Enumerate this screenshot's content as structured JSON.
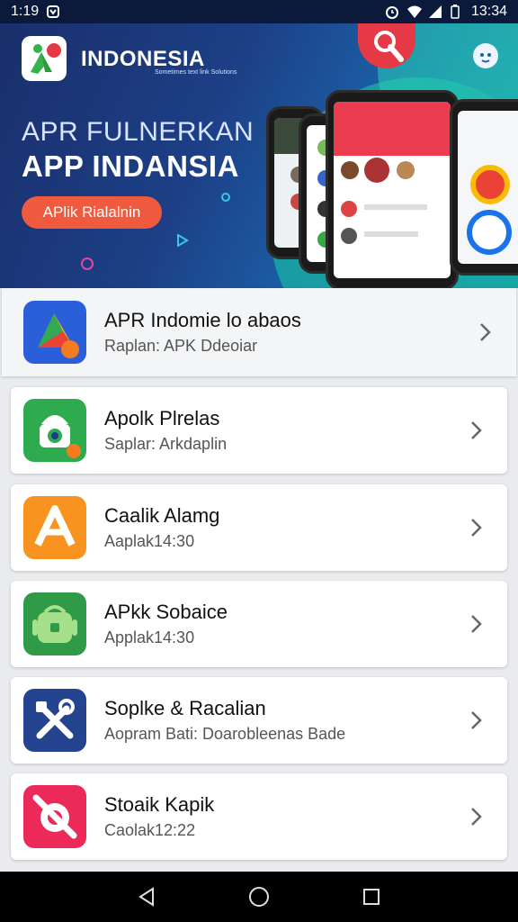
{
  "status_bar": {
    "time_left": "1:19",
    "time_right": "13:34"
  },
  "banner": {
    "brand_name": "INDONESIA",
    "brand_tagline": "Sometimes text link Solutions",
    "headline_1": "APR FULNERKAN",
    "headline_2": "APP INDANSIA",
    "cta_label": "APlik Rialalnin"
  },
  "apps": [
    {
      "title": "APR Indomie lo abaos",
      "subtitle": "Raplan: APK Ddeoiar",
      "icon": "play-store-icon",
      "icon_color": "#2b5fd9"
    },
    {
      "title": "Apolk Plrelas",
      "subtitle": "Saplar: Arkdaplin",
      "icon": "camera-lock-icon",
      "icon_color": "#2eaa4f"
    },
    {
      "title": "Caalik Alamg",
      "subtitle": "Aaplak14:30",
      "icon": "letter-a-icon",
      "icon_color": "#f7931e"
    },
    {
      "title": "APkk Sobaice",
      "subtitle": "Applak14:30",
      "icon": "android-bag-icon",
      "icon_color": "#2f9b48"
    },
    {
      "title": "Soplke & Racalian",
      "subtitle": "Aopram Bati: Doarobleenas Bade",
      "icon": "tools-icon",
      "icon_color": "#24448f"
    },
    {
      "title": "Stoaik Kapik",
      "subtitle": "Caolak12:22",
      "icon": "no-camera-icon",
      "icon_color": "#ec2a5a"
    }
  ],
  "colors": {
    "banner_start": "#1a2f6b",
    "banner_end": "#17a9a8",
    "cta": "#f05a3e",
    "accent_red": "#e63946"
  }
}
